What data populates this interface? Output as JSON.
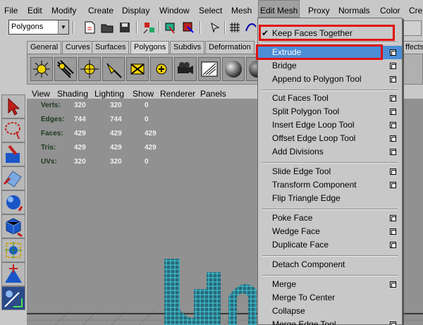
{
  "menubar": {
    "items": [
      "File",
      "Edit",
      "Modify",
      "Create",
      "Display",
      "Window",
      "Select",
      "Mesh",
      "Edit Mesh",
      "Proxy",
      "Normals",
      "Color",
      "Cre"
    ]
  },
  "statusline": {
    "mode_value": "Polygons"
  },
  "shelf": {
    "tabs": [
      "General",
      "Curves",
      "Surfaces",
      "Polygons",
      "Subdivs",
      "Deformation",
      "ffects"
    ]
  },
  "panel_menu": {
    "items": [
      "View",
      "Shading",
      "Lighting",
      "Show",
      "Renderer",
      "Panels"
    ]
  },
  "hud": {
    "rows": [
      {
        "label": "Verts:",
        "values": [
          "320",
          "320",
          "0"
        ]
      },
      {
        "label": "Edges:",
        "values": [
          "744",
          "744",
          "0"
        ]
      },
      {
        "label": "Faces:",
        "values": [
          "429",
          "429",
          "429"
        ]
      },
      {
        "label": "Tris:",
        "values": [
          "429",
          "429",
          "429"
        ]
      },
      {
        "label": "UVs:",
        "values": [
          "320",
          "320",
          "0"
        ]
      }
    ]
  },
  "edit_mesh_menu": {
    "items": [
      {
        "label": "Keep Faces Together",
        "checked": true
      },
      {
        "label": "Extrude",
        "highlighted": true
      },
      {
        "label": "Bridge"
      },
      {
        "label": "Append to Polygon Tool"
      },
      {
        "label": "Cut Faces Tool"
      },
      {
        "label": "Split Polygon Tool"
      },
      {
        "label": "Insert Edge Loop Tool"
      },
      {
        "label": "Offset Edge Loop Tool"
      },
      {
        "label": "Add Divisions"
      },
      {
        "label": "Slide Edge Tool"
      },
      {
        "label": "Transform Component"
      },
      {
        "label": "Flip Triangle Edge"
      },
      {
        "label": "Poke Face"
      },
      {
        "label": "Wedge Face"
      },
      {
        "label": "Duplicate Face"
      },
      {
        "label": "Detach Component"
      },
      {
        "label": "Merge"
      },
      {
        "label": "Merge To Center"
      },
      {
        "label": "Collapse"
      },
      {
        "label": "Merge Edge Tool"
      }
    ]
  },
  "colors": {
    "highlight": "#4c8ed6",
    "annotation_red": "#e01010",
    "mesh_cyan": "#3fd0e0",
    "hud_label": "#1c3a1c"
  }
}
